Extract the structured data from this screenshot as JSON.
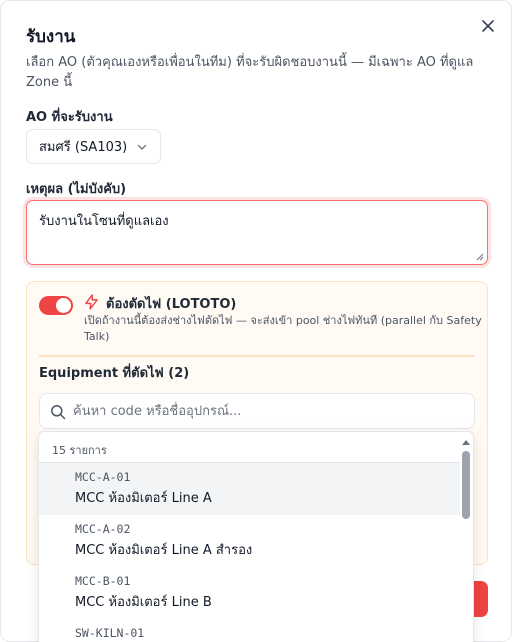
{
  "dialog": {
    "title": "รับงาน",
    "subtitle": "เลือก AO (ตัวคุณเองหรือเพื่อนในทีม) ที่จะรับผิดชอบงานนี้ — มีเฉพาะ AO ที่ดูแล Zone นี้"
  },
  "ao_field": {
    "label": "AO ที่จะรับงาน",
    "selected": "สมศรี (SA103)"
  },
  "reason_field": {
    "label": "เหตุผล (ไม่บังคับ)",
    "value": "รับงานในโซนที่ดูแลเอง"
  },
  "loto": {
    "enabled": true,
    "title": "ต้องตัดไฟ (LOTOTO)",
    "description": "เปิดถ้างานนี้ต้องส่งช่างไฟตัดไฟ — จะส่งเข้า pool ช่างไฟทันที (parallel กับ Safety Talk)",
    "equipment_label": "Equipment ที่ตัดไฟ (2)",
    "search_placeholder": "ค้นหา code หรือชื่ออุปกรณ์..."
  },
  "dropdown": {
    "count_text": "15 รายการ",
    "options": [
      {
        "code": "MCC-A-01",
        "name": "MCC ห้องมิเตอร์ Line A"
      },
      {
        "code": "MCC-A-02",
        "name": "MCC ห้องมิเตอร์ Line A สำรอง"
      },
      {
        "code": "MCC-B-01",
        "name": "MCC ห้องมิเตอร์ Line B"
      },
      {
        "code": "SW-KILN-01",
        "name": ""
      }
    ]
  },
  "colors": {
    "accent": "#ef4444",
    "panel_bg": "#fffaf3",
    "panel_border": "#fde3c4"
  }
}
